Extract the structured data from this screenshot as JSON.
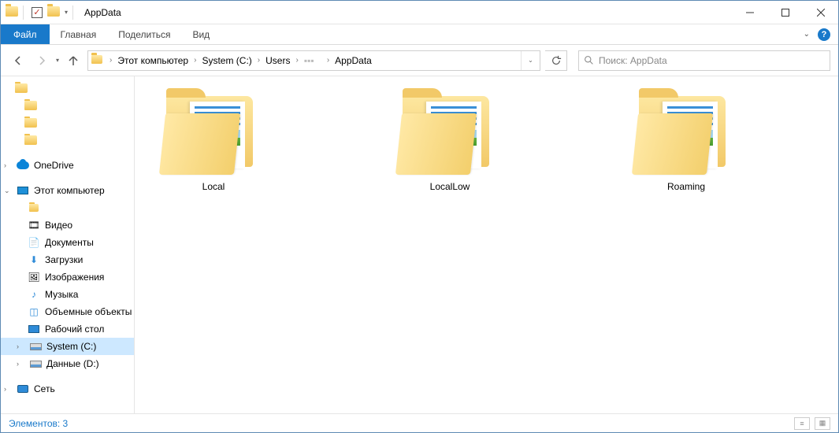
{
  "window": {
    "title": "AppData",
    "qat_checked": true,
    "min": "Свернуть",
    "max": "Развернуть",
    "close": "Закрыть"
  },
  "ribbon": {
    "file": "Файл",
    "tabs": [
      "Главная",
      "Поделиться",
      "Вид"
    ]
  },
  "nav": {
    "back": "Назад",
    "forward": "Вперёд",
    "up": "Вверх",
    "breadcrumbs": [
      "Этот компьютер",
      "System (C:)",
      "Users",
      "",
      "AppData"
    ],
    "refresh": "Обновить",
    "search_placeholder": "Поиск: AppData"
  },
  "sidebar": {
    "onedrive": "OneDrive",
    "thispc": "Этот компьютер",
    "items": [
      {
        "label": "Видео"
      },
      {
        "label": "Документы"
      },
      {
        "label": "Загрузки"
      },
      {
        "label": "Изображения"
      },
      {
        "label": "Музыка"
      },
      {
        "label": "Объемные объекты"
      },
      {
        "label": "Рабочий стол"
      },
      {
        "label": "System (C:)",
        "selected": true
      },
      {
        "label": "Данные (D:)"
      }
    ],
    "network": "Сеть"
  },
  "content": {
    "folders": [
      "Local",
      "LocalLow",
      "Roaming"
    ]
  },
  "statusbar": {
    "count_label": "Элементов: 3"
  }
}
